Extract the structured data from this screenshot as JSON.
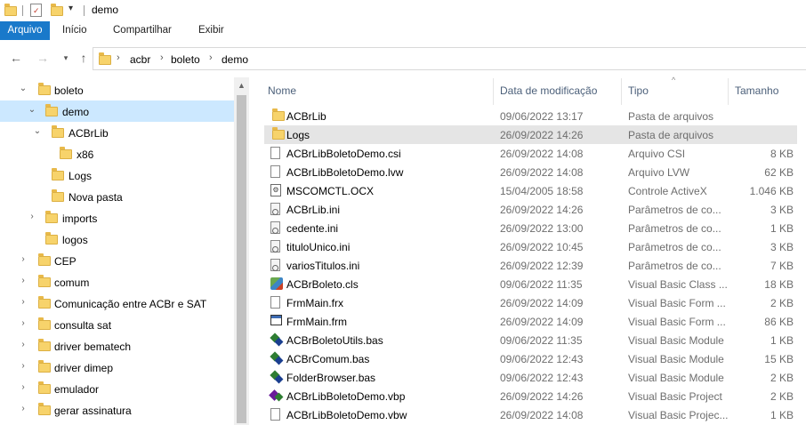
{
  "window": {
    "title": "demo"
  },
  "quick_access": [
    {
      "icon": "folder-icon"
    },
    {
      "icon": "properties-checklist-icon"
    },
    {
      "icon": "new-folder-icon"
    },
    {
      "icon": "customize-dropdown-icon"
    }
  ],
  "ribbon": {
    "tabs": [
      {
        "label": "Arquivo",
        "active": true
      },
      {
        "label": "Início"
      },
      {
        "label": "Compartilhar"
      },
      {
        "label": "Exibir"
      }
    ]
  },
  "address": {
    "breadcrumbs": [
      "acbr",
      "boleto",
      "demo"
    ]
  },
  "tree": [
    {
      "label": "boleto",
      "expanded": true
    },
    {
      "label": "demo",
      "expanded": true,
      "selected": true
    },
    {
      "label": "ACBrLib",
      "expanded": true
    },
    {
      "label": "x86"
    },
    {
      "label": "Logs"
    },
    {
      "label": "Nova pasta"
    },
    {
      "label": "imports",
      "collapsed": true
    },
    {
      "label": "logos"
    },
    {
      "label": "CEP",
      "collapsed": true
    },
    {
      "label": "comum",
      "collapsed": true
    },
    {
      "label": "Comunicação entre ACBr e SAT",
      "collapsed": true
    },
    {
      "label": "consulta sat",
      "collapsed": true
    },
    {
      "label": "driver bematech",
      "collapsed": true
    },
    {
      "label": "driver dimep",
      "collapsed": true
    },
    {
      "label": "emulador",
      "collapsed": true
    },
    {
      "label": "gerar assinatura",
      "collapsed": true
    }
  ],
  "columns": {
    "name": "Nome",
    "date": "Data de modificação",
    "type": "Tipo",
    "size": "Tamanho"
  },
  "files": [
    {
      "name": "ACBrLib",
      "date": "09/06/2022 13:17",
      "type": "Pasta de arquivos",
      "size": "",
      "icon": "folder-icon"
    },
    {
      "name": "Logs",
      "date": "26/09/2022 14:26",
      "type": "Pasta de arquivos",
      "size": "",
      "icon": "folder-icon"
    },
    {
      "name": "ACBrLibBoletoDemo.csi",
      "date": "26/09/2022 14:08",
      "type": "Arquivo CSI",
      "size": "8 KB",
      "icon": "document-icon"
    },
    {
      "name": "ACBrLibBoletoDemo.lvw",
      "date": "26/09/2022 14:08",
      "type": "Arquivo LVW",
      "size": "62 KB",
      "icon": "document-icon"
    },
    {
      "name": "MSCOMCTL.OCX",
      "date": "15/04/2005 18:58",
      "type": "Controle ActiveX",
      "size": "1.046 KB",
      "icon": "activex-icon"
    },
    {
      "name": "ACBrLib.ini",
      "date": "26/09/2022 14:26",
      "type": "Parâmetros de co...",
      "size": "3 KB",
      "icon": "settings-file-icon"
    },
    {
      "name": "cedente.ini",
      "date": "26/09/2022 13:00",
      "type": "Parâmetros de co...",
      "size": "1 KB",
      "icon": "settings-file-icon"
    },
    {
      "name": "tituloUnico.ini",
      "date": "26/09/2022 10:45",
      "type": "Parâmetros de co...",
      "size": "3 KB",
      "icon": "settings-file-icon"
    },
    {
      "name": "variosTitulos.ini",
      "date": "26/09/2022 12:39",
      "type": "Parâmetros de co...",
      "size": "7 KB",
      "icon": "settings-file-icon"
    },
    {
      "name": "ACBrBoleto.cls",
      "date": "09/06/2022 11:35",
      "type": "Visual Basic Class ...",
      "size": "18 KB",
      "icon": "vb-class-icon"
    },
    {
      "name": "FrmMain.frx",
      "date": "26/09/2022 14:09",
      "type": "Visual Basic Form ...",
      "size": "2 KB",
      "icon": "vb-form-icon"
    },
    {
      "name": "FrmMain.frm",
      "date": "26/09/2022 14:09",
      "type": "Visual Basic Form ...",
      "size": "86 KB",
      "icon": "vb-form-icon"
    },
    {
      "name": "ACBrBoletoUtils.bas",
      "date": "09/06/2022 11:35",
      "type": "Visual Basic Module",
      "size": "1 KB",
      "icon": "vb-module-icon"
    },
    {
      "name": "ACBrComum.bas",
      "date": "09/06/2022 12:43",
      "type": "Visual Basic Module",
      "size": "15 KB",
      "icon": "vb-module-icon"
    },
    {
      "name": "FolderBrowser.bas",
      "date": "09/06/2022 12:43",
      "type": "Visual Basic Module",
      "size": "2 KB",
      "icon": "vb-module-icon"
    },
    {
      "name": "ACBrLibBoletoDemo.vbp",
      "date": "26/09/2022 14:26",
      "type": "Visual Basic Project",
      "size": "2 KB",
      "icon": "vb-project-icon"
    },
    {
      "name": "ACBrLibBoletoDemo.vbw",
      "date": "26/09/2022 14:08",
      "type": "Visual Basic Projec...",
      "size": "1 KB",
      "icon": "document-icon"
    }
  ],
  "colors": {
    "accent": "#1979ca",
    "selection": "#cce8ff",
    "hover": "#e5e5e5",
    "folder": "#f7d36b"
  }
}
